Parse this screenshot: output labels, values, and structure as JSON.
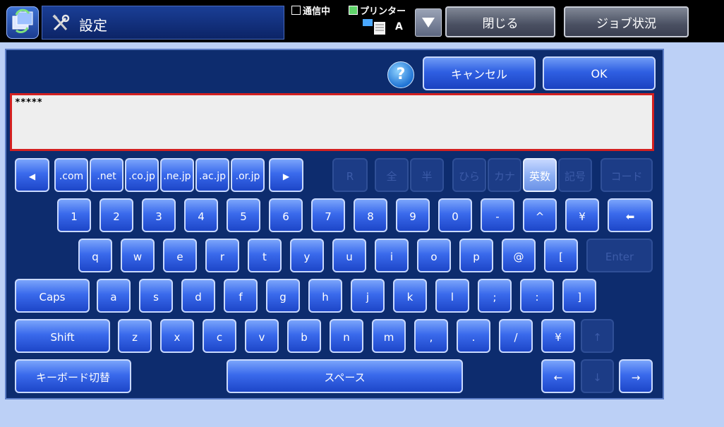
{
  "header": {
    "title": "設定",
    "status_communicating": "通信中",
    "status_printer": "プリンター",
    "printer_label": "A",
    "close_label": "閉じる",
    "job_status_label": "ジョブ状況"
  },
  "dialog": {
    "help_label": "?",
    "cancel_label": "キャンセル",
    "ok_label": "OK",
    "input_value": "*****"
  },
  "keyboard": {
    "row0_domain": [
      {
        "id": "left",
        "label": "◀"
      },
      {
        "id": "com",
        "label": ".com"
      },
      {
        "id": "net",
        "label": ".net"
      },
      {
        "id": "cojp",
        "label": ".co.jp"
      },
      {
        "id": "nejp",
        "label": ".ne.jp"
      },
      {
        "id": "acjp",
        "label": ".ac.jp"
      },
      {
        "id": "orjp",
        "label": ".or.jp"
      },
      {
        "id": "right",
        "label": "▶"
      }
    ],
    "row0_modes": [
      {
        "id": "r",
        "label": "R",
        "state": "disabled"
      },
      {
        "id": "zen",
        "label": "全",
        "state": "disabled"
      },
      {
        "id": "han",
        "label": "半",
        "state": "disabled"
      },
      {
        "id": "hira",
        "label": "ひら",
        "state": "disabled"
      },
      {
        "id": "kana",
        "label": "カナ",
        "state": "disabled"
      },
      {
        "id": "eisu",
        "label": "英数",
        "state": "selected"
      },
      {
        "id": "kigo",
        "label": "記号",
        "state": "disabled"
      },
      {
        "id": "code",
        "label": "コード",
        "state": "disabled"
      }
    ],
    "row1": [
      "1",
      "2",
      "3",
      "4",
      "5",
      "6",
      "7",
      "8",
      "9",
      "0",
      "-",
      "^",
      "¥"
    ],
    "backspace_label": "⬅",
    "row2": [
      "q",
      "w",
      "e",
      "r",
      "t",
      "y",
      "u",
      "i",
      "o",
      "p",
      "@",
      "["
    ],
    "enter_label": "Enter",
    "caps_label": "Caps",
    "row3": [
      "a",
      "s",
      "d",
      "f",
      "g",
      "h",
      "j",
      "k",
      "l",
      ";",
      ":",
      "]"
    ],
    "shift_label": "Shift",
    "row4": [
      "z",
      "x",
      "c",
      "v",
      "b",
      "n",
      "m",
      ",",
      ".",
      "/",
      "¥"
    ],
    "up_label": "↑",
    "switch_label": "キーボード切替",
    "space_label": "スペース",
    "arrow_left": "←",
    "arrow_down": "↓",
    "arrow_right": "→"
  },
  "colors": {
    "panel_bg": "#0d2c6e",
    "key_blue": "#2f5fe2",
    "input_border": "#d32020",
    "page_bg": "#bcd0f6"
  }
}
